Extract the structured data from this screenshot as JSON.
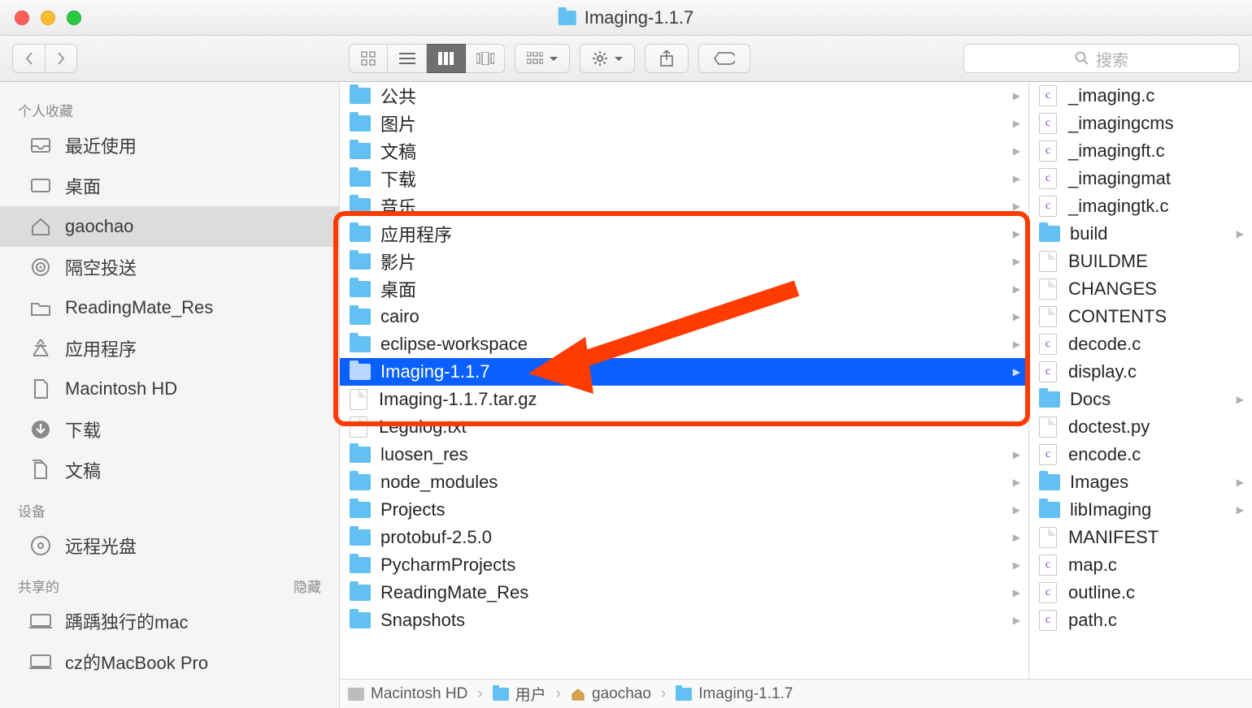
{
  "window": {
    "title": "Imaging-1.1.7"
  },
  "toolbar": {
    "active_view": 2,
    "search_placeholder": "搜索"
  },
  "sidebar": {
    "sections": [
      {
        "title": "个人收藏",
        "items": [
          {
            "icon": "tray",
            "label": "最近使用"
          },
          {
            "icon": "desktop",
            "label": "桌面"
          },
          {
            "icon": "home",
            "label": "gaochao",
            "selected": true
          },
          {
            "icon": "airdrop",
            "label": "隔空投送"
          },
          {
            "icon": "folder",
            "label": "ReadingMate_Res"
          },
          {
            "icon": "app",
            "label": "应用程序"
          },
          {
            "icon": "doc",
            "label": "Macintosh HD"
          },
          {
            "icon": "download",
            "label": "下载"
          },
          {
            "icon": "docs",
            "label": "文稿"
          }
        ]
      },
      {
        "title": "设备",
        "items": [
          {
            "icon": "disc",
            "label": "远程光盘"
          }
        ]
      },
      {
        "title": "共享的",
        "hide_label": "隐藏",
        "items": [
          {
            "icon": "mac",
            "label": "踽踽独行的mac"
          },
          {
            "icon": "mac",
            "label": "cz的MacBook Pro"
          }
        ]
      }
    ]
  },
  "columns": {
    "c1": [
      {
        "type": "folder",
        "name": "公共",
        "arrow": true
      },
      {
        "type": "folder",
        "name": "图片",
        "arrow": true,
        "variant": "photo"
      },
      {
        "type": "folder",
        "name": "文稿",
        "arrow": true
      },
      {
        "type": "folder",
        "name": "下载",
        "arrow": true
      },
      {
        "type": "folder",
        "name": "音乐",
        "arrow": true
      },
      {
        "type": "folder",
        "name": "应用程序",
        "arrow": true
      },
      {
        "type": "folder",
        "name": "影片",
        "arrow": true
      },
      {
        "type": "folder",
        "name": "桌面",
        "arrow": true
      },
      {
        "type": "folder",
        "name": "cairo",
        "arrow": true
      },
      {
        "type": "folder",
        "name": "eclipse-workspace",
        "arrow": true
      },
      {
        "type": "folder",
        "name": "Imaging-1.1.7",
        "arrow": true,
        "selected": true
      },
      {
        "type": "file",
        "name": "Imaging-1.1.7.tar.gz"
      },
      {
        "type": "file",
        "name": "Legulog.txt"
      },
      {
        "type": "folder",
        "name": "luosen_res",
        "arrow": true
      },
      {
        "type": "folder",
        "name": "node_modules",
        "arrow": true
      },
      {
        "type": "folder",
        "name": "Projects",
        "arrow": true
      },
      {
        "type": "folder",
        "name": "protobuf-2.5.0",
        "arrow": true
      },
      {
        "type": "folder",
        "name": "PycharmProjects",
        "arrow": true
      },
      {
        "type": "folder",
        "name": "ReadingMate_Res",
        "arrow": true
      },
      {
        "type": "folder",
        "name": "Snapshots",
        "arrow": true
      }
    ],
    "c2": [
      {
        "type": "cfile",
        "name": "_imaging.c"
      },
      {
        "type": "cfile",
        "name": "_imagingcms"
      },
      {
        "type": "cfile",
        "name": "_imagingft.c"
      },
      {
        "type": "cfile",
        "name": "_imagingmat"
      },
      {
        "type": "cfile",
        "name": "_imagingtk.c"
      },
      {
        "type": "folder",
        "name": "build",
        "arrow": true
      },
      {
        "type": "file",
        "name": "BUILDME"
      },
      {
        "type": "file",
        "name": "CHANGES"
      },
      {
        "type": "file",
        "name": "CONTENTS"
      },
      {
        "type": "cfile",
        "name": "decode.c"
      },
      {
        "type": "cfile",
        "name": "display.c"
      },
      {
        "type": "folder",
        "name": "Docs",
        "arrow": true
      },
      {
        "type": "file",
        "name": "doctest.py"
      },
      {
        "type": "cfile",
        "name": "encode.c"
      },
      {
        "type": "folder",
        "name": "Images",
        "arrow": true
      },
      {
        "type": "folder",
        "name": "libImaging",
        "arrow": true
      },
      {
        "type": "file",
        "name": "MANIFEST"
      },
      {
        "type": "cfile",
        "name": "map.c"
      },
      {
        "type": "cfile",
        "name": "outline.c"
      },
      {
        "type": "cfile",
        "name": "path.c"
      }
    ]
  },
  "pathbar": [
    {
      "icon": "hd",
      "label": "Macintosh HD"
    },
    {
      "icon": "folder-user",
      "label": "用户"
    },
    {
      "icon": "home",
      "label": "gaochao"
    },
    {
      "icon": "folder",
      "label": "Imaging-1.1.7"
    }
  ]
}
